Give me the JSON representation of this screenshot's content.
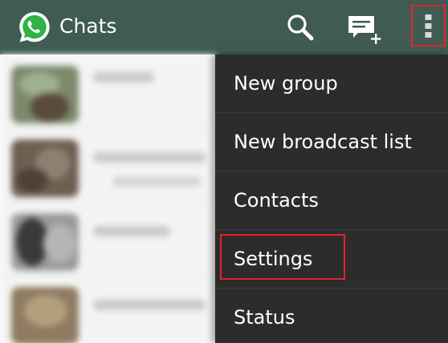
{
  "topbar": {
    "title": "Chats",
    "logo_icon": "whatsapp-logo-icon",
    "search_icon": "search-icon",
    "compose_icon": "new-chat-icon",
    "overflow_icon": "more-vertical-icon",
    "background_color": "#3f5b52",
    "highlight_color": "#e4232f"
  },
  "menu": {
    "items": [
      {
        "label": "New group"
      },
      {
        "label": "New broadcast list"
      },
      {
        "label": "Contacts"
      },
      {
        "label": "Settings"
      },
      {
        "label": "Status"
      }
    ],
    "highlighted_item": "Settings",
    "background_color": "#2c2c2c"
  },
  "chat_list": {
    "rows": 4,
    "blurred": true
  }
}
